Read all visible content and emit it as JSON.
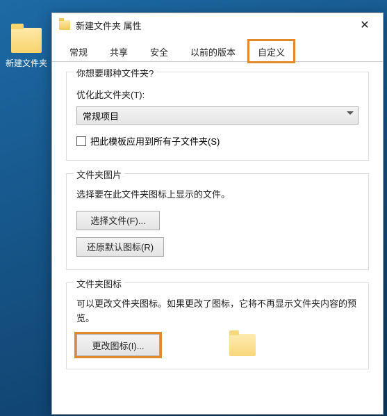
{
  "desktop": {
    "folder_label": "新建文件夹"
  },
  "dialog": {
    "title": "新建文件夹 属性",
    "close_glyph": "✕",
    "tabs": {
      "general": "常规",
      "sharing": "共享",
      "security": "安全",
      "previous": "以前的版本",
      "customize": "自定义"
    },
    "group1": {
      "legend": "你想要哪种文件夹?",
      "optimize_label": "优化此文件夹(T):",
      "optimize_value": "常规项目",
      "apply_checkbox": "把此模板应用到所有子文件夹(S)"
    },
    "group2": {
      "legend": "文件夹图片",
      "desc": "选择要在此文件夹图标上显示的文件。",
      "choose_btn": "选择文件(F)...",
      "restore_btn": "还原默认图标(R)"
    },
    "group3": {
      "legend": "文件夹图标",
      "desc": "可以更改文件夹图标。如果更改了图标，它将不再显示文件夹内容的预览。",
      "change_btn": "更改图标(I)..."
    }
  }
}
